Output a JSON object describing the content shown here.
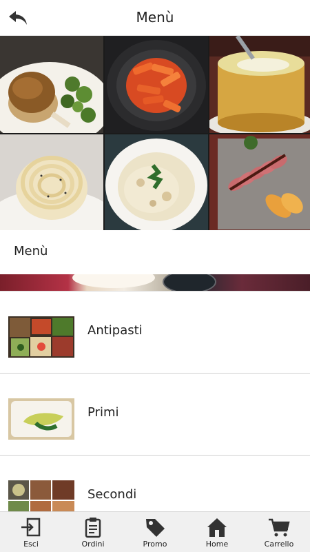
{
  "header": {
    "title": "Menù"
  },
  "section": {
    "title": "Menù"
  },
  "categories": [
    {
      "label": "Antipasti"
    },
    {
      "label": "Primi"
    },
    {
      "label": "Secondi"
    }
  ],
  "nav": {
    "items": [
      {
        "label": "Esci",
        "icon": "logout-icon"
      },
      {
        "label": "Ordini",
        "icon": "clipboard-icon"
      },
      {
        "label": "Promo",
        "icon": "tag-icon"
      },
      {
        "label": "Home",
        "icon": "home-icon"
      },
      {
        "label": "Carrello",
        "icon": "cart-icon"
      }
    ]
  },
  "colors": {
    "text": "#222222",
    "nav_bg": "#f0f0f0",
    "header_bg": "#ffffff"
  }
}
